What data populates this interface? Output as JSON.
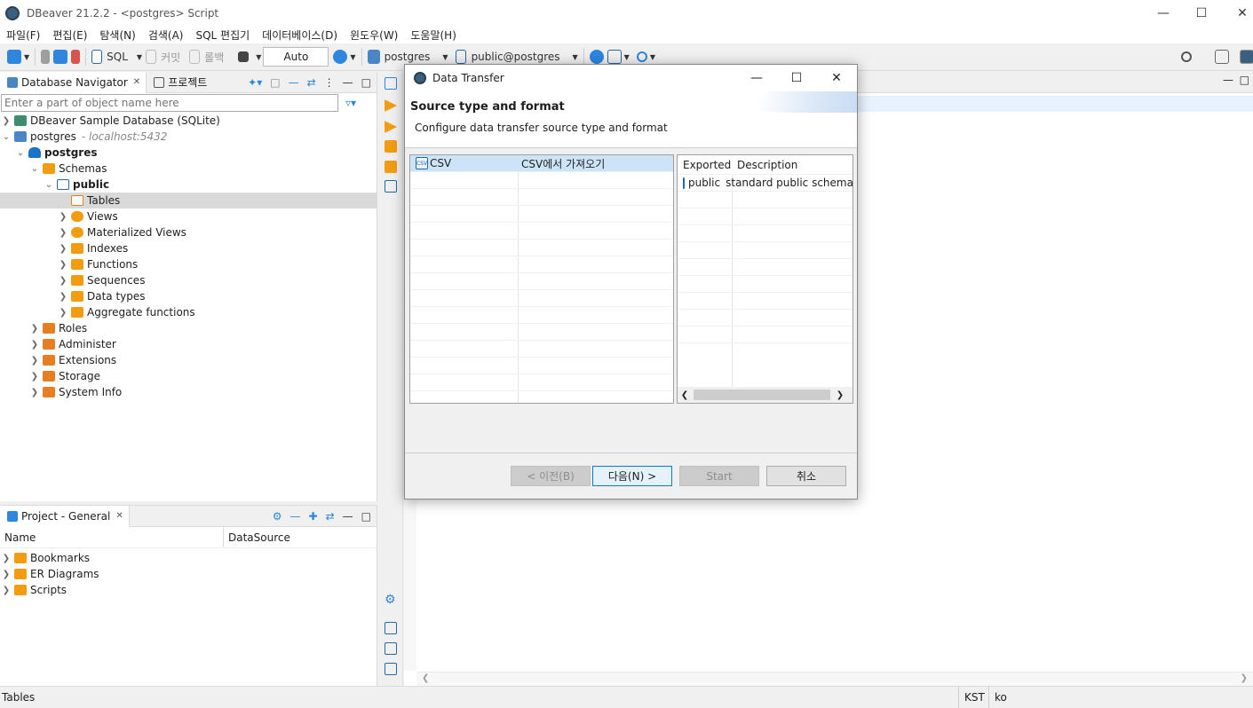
{
  "window": {
    "title": "DBeaver 21.2.2 - <postgres> Script"
  },
  "menu": [
    "파일(F)",
    "편집(E)",
    "탐색(N)",
    "검색(A)",
    "SQL 편집기",
    "데이터베이스(D)",
    "윈도우(W)",
    "도움말(H)"
  ],
  "toolbar": {
    "sql_label": "SQL",
    "commit_label": "커밋",
    "rollback_label": "롤백",
    "auto_label": "Auto",
    "datasource_label": "postgres",
    "schema_label": "public@postgres"
  },
  "navigator": {
    "tab_label": "Database Navigator",
    "tab2_label": "프로젝트",
    "filter_placeholder": "Enter a part of object name here",
    "tree": [
      {
        "label": "DBeaver Sample Database (SQLite)"
      },
      {
        "label": "postgres",
        "hint": "- localhost:5432"
      },
      {
        "label": "postgres"
      },
      {
        "label": "Schemas"
      },
      {
        "label": "public"
      },
      {
        "label": "Tables"
      },
      {
        "label": "Views"
      },
      {
        "label": "Materialized Views"
      },
      {
        "label": "Indexes"
      },
      {
        "label": "Functions"
      },
      {
        "label": "Sequences"
      },
      {
        "label": "Data types"
      },
      {
        "label": "Aggregate functions"
      },
      {
        "label": "Roles"
      },
      {
        "label": "Administer"
      },
      {
        "label": "Extensions"
      },
      {
        "label": "Storage"
      },
      {
        "label": "System Info"
      }
    ]
  },
  "project": {
    "tab_label": "Project - General",
    "col_name": "Name",
    "col_datasource": "DataSource",
    "items": [
      {
        "label": "Bookmarks"
      },
      {
        "label": "ER Diagrams"
      },
      {
        "label": "Scripts"
      }
    ]
  },
  "dialog": {
    "title": "Data Transfer",
    "heading": "Source type and format",
    "subheading": "Configure data transfer source type and format",
    "formats": [
      {
        "name": "CSV",
        "description": "CSV에서 가져오기"
      }
    ],
    "targets_headers": {
      "exported": "Exported",
      "description": "Description"
    },
    "targets": [
      {
        "name": "public",
        "description": "standard public schema"
      }
    ],
    "buttons": {
      "back": "< 이전(B)",
      "next": "다음(N) >",
      "start": "Start",
      "cancel": "취소"
    }
  },
  "status": {
    "selection": "Tables",
    "timezone": "KST",
    "locale": "ko"
  }
}
